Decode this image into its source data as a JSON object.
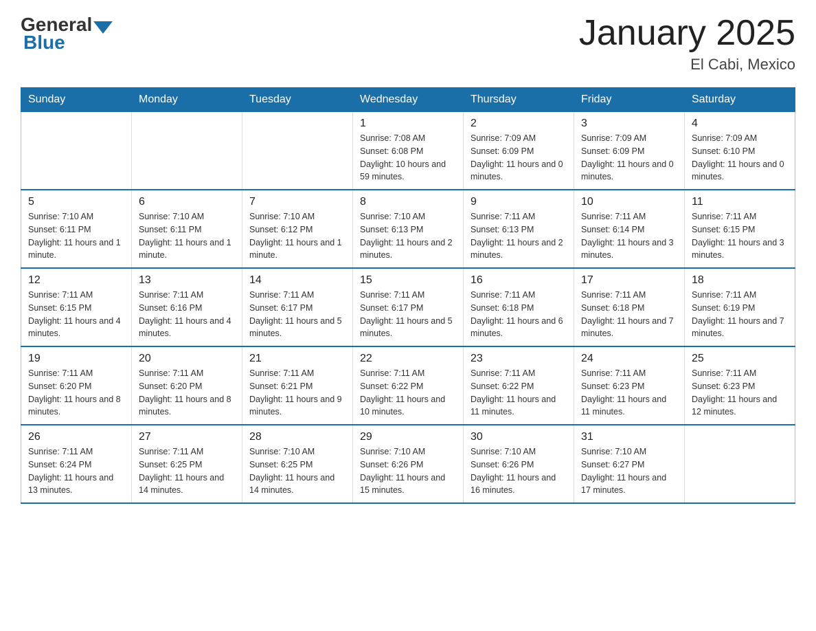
{
  "header": {
    "logo_general": "General",
    "logo_blue": "Blue",
    "title": "January 2025",
    "location": "El Cabi, Mexico"
  },
  "days_of_week": [
    "Sunday",
    "Monday",
    "Tuesday",
    "Wednesday",
    "Thursday",
    "Friday",
    "Saturday"
  ],
  "weeks": [
    [
      {
        "day": "",
        "info": ""
      },
      {
        "day": "",
        "info": ""
      },
      {
        "day": "",
        "info": ""
      },
      {
        "day": "1",
        "info": "Sunrise: 7:08 AM\nSunset: 6:08 PM\nDaylight: 10 hours and 59 minutes."
      },
      {
        "day": "2",
        "info": "Sunrise: 7:09 AM\nSunset: 6:09 PM\nDaylight: 11 hours and 0 minutes."
      },
      {
        "day": "3",
        "info": "Sunrise: 7:09 AM\nSunset: 6:09 PM\nDaylight: 11 hours and 0 minutes."
      },
      {
        "day": "4",
        "info": "Sunrise: 7:09 AM\nSunset: 6:10 PM\nDaylight: 11 hours and 0 minutes."
      }
    ],
    [
      {
        "day": "5",
        "info": "Sunrise: 7:10 AM\nSunset: 6:11 PM\nDaylight: 11 hours and 1 minute."
      },
      {
        "day": "6",
        "info": "Sunrise: 7:10 AM\nSunset: 6:11 PM\nDaylight: 11 hours and 1 minute."
      },
      {
        "day": "7",
        "info": "Sunrise: 7:10 AM\nSunset: 6:12 PM\nDaylight: 11 hours and 1 minute."
      },
      {
        "day": "8",
        "info": "Sunrise: 7:10 AM\nSunset: 6:13 PM\nDaylight: 11 hours and 2 minutes."
      },
      {
        "day": "9",
        "info": "Sunrise: 7:11 AM\nSunset: 6:13 PM\nDaylight: 11 hours and 2 minutes."
      },
      {
        "day": "10",
        "info": "Sunrise: 7:11 AM\nSunset: 6:14 PM\nDaylight: 11 hours and 3 minutes."
      },
      {
        "day": "11",
        "info": "Sunrise: 7:11 AM\nSunset: 6:15 PM\nDaylight: 11 hours and 3 minutes."
      }
    ],
    [
      {
        "day": "12",
        "info": "Sunrise: 7:11 AM\nSunset: 6:15 PM\nDaylight: 11 hours and 4 minutes."
      },
      {
        "day": "13",
        "info": "Sunrise: 7:11 AM\nSunset: 6:16 PM\nDaylight: 11 hours and 4 minutes."
      },
      {
        "day": "14",
        "info": "Sunrise: 7:11 AM\nSunset: 6:17 PM\nDaylight: 11 hours and 5 minutes."
      },
      {
        "day": "15",
        "info": "Sunrise: 7:11 AM\nSunset: 6:17 PM\nDaylight: 11 hours and 5 minutes."
      },
      {
        "day": "16",
        "info": "Sunrise: 7:11 AM\nSunset: 6:18 PM\nDaylight: 11 hours and 6 minutes."
      },
      {
        "day": "17",
        "info": "Sunrise: 7:11 AM\nSunset: 6:18 PM\nDaylight: 11 hours and 7 minutes."
      },
      {
        "day": "18",
        "info": "Sunrise: 7:11 AM\nSunset: 6:19 PM\nDaylight: 11 hours and 7 minutes."
      }
    ],
    [
      {
        "day": "19",
        "info": "Sunrise: 7:11 AM\nSunset: 6:20 PM\nDaylight: 11 hours and 8 minutes."
      },
      {
        "day": "20",
        "info": "Sunrise: 7:11 AM\nSunset: 6:20 PM\nDaylight: 11 hours and 8 minutes."
      },
      {
        "day": "21",
        "info": "Sunrise: 7:11 AM\nSunset: 6:21 PM\nDaylight: 11 hours and 9 minutes."
      },
      {
        "day": "22",
        "info": "Sunrise: 7:11 AM\nSunset: 6:22 PM\nDaylight: 11 hours and 10 minutes."
      },
      {
        "day": "23",
        "info": "Sunrise: 7:11 AM\nSunset: 6:22 PM\nDaylight: 11 hours and 11 minutes."
      },
      {
        "day": "24",
        "info": "Sunrise: 7:11 AM\nSunset: 6:23 PM\nDaylight: 11 hours and 11 minutes."
      },
      {
        "day": "25",
        "info": "Sunrise: 7:11 AM\nSunset: 6:23 PM\nDaylight: 11 hours and 12 minutes."
      }
    ],
    [
      {
        "day": "26",
        "info": "Sunrise: 7:11 AM\nSunset: 6:24 PM\nDaylight: 11 hours and 13 minutes."
      },
      {
        "day": "27",
        "info": "Sunrise: 7:11 AM\nSunset: 6:25 PM\nDaylight: 11 hours and 14 minutes."
      },
      {
        "day": "28",
        "info": "Sunrise: 7:10 AM\nSunset: 6:25 PM\nDaylight: 11 hours and 14 minutes."
      },
      {
        "day": "29",
        "info": "Sunrise: 7:10 AM\nSunset: 6:26 PM\nDaylight: 11 hours and 15 minutes."
      },
      {
        "day": "30",
        "info": "Sunrise: 7:10 AM\nSunset: 6:26 PM\nDaylight: 11 hours and 16 minutes."
      },
      {
        "day": "31",
        "info": "Sunrise: 7:10 AM\nSunset: 6:27 PM\nDaylight: 11 hours and 17 minutes."
      },
      {
        "day": "",
        "info": ""
      }
    ]
  ]
}
